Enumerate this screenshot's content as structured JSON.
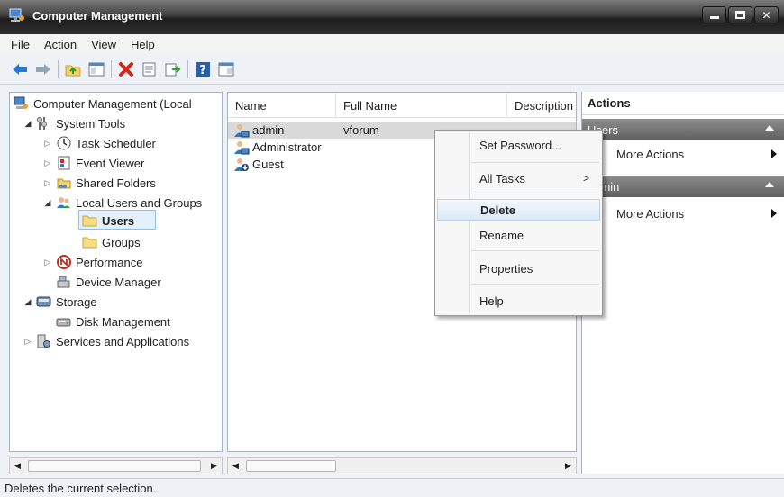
{
  "window": {
    "title": "Computer Management"
  },
  "menubar": {
    "items": [
      "File",
      "Action",
      "View",
      "Help"
    ]
  },
  "toolbar": {
    "buttons": [
      "back-arrow-icon",
      "forward-arrow-icon",
      "up-folder-icon",
      "show-hide-tree-icon",
      "delete-icon",
      "properties-icon",
      "export-list-icon",
      "help-icon",
      "show-hide-action-pane-icon"
    ]
  },
  "tree": {
    "root": "Computer Management (Local",
    "system_tools": "System Tools",
    "task_scheduler": "Task Scheduler",
    "event_viewer": "Event Viewer",
    "shared_folders": "Shared Folders",
    "local_users_groups": "Local Users and Groups",
    "users": "Users",
    "groups": "Groups",
    "performance": "Performance",
    "device_manager": "Device Manager",
    "storage": "Storage",
    "disk_management": "Disk Management",
    "services_apps": "Services and Applications"
  },
  "list": {
    "columns": [
      "Name",
      "Full Name",
      "Description"
    ],
    "rows": [
      {
        "name": "admin",
        "full_name": "vforum",
        "description": ""
      },
      {
        "name": "Administrator",
        "full_name": "",
        "description": ""
      },
      {
        "name": "Guest",
        "full_name": "",
        "description": ""
      }
    ]
  },
  "actions": {
    "title": "Actions",
    "group1": "Users",
    "group1_more": "More Actions",
    "group2": "admin",
    "group2_more": "More Actions"
  },
  "context_menu": {
    "set_password": "Set Password...",
    "all_tasks": "All Tasks",
    "all_tasks_arrow": ">",
    "delete": "Delete",
    "rename": "Rename",
    "properties": "Properties",
    "help": "Help"
  },
  "statusbar": {
    "text": "Deletes the current selection."
  },
  "colors": {
    "accent_blue": "#2a78c8",
    "delete_red": "#d4261d",
    "folder_yellow": "#f2d36b"
  }
}
